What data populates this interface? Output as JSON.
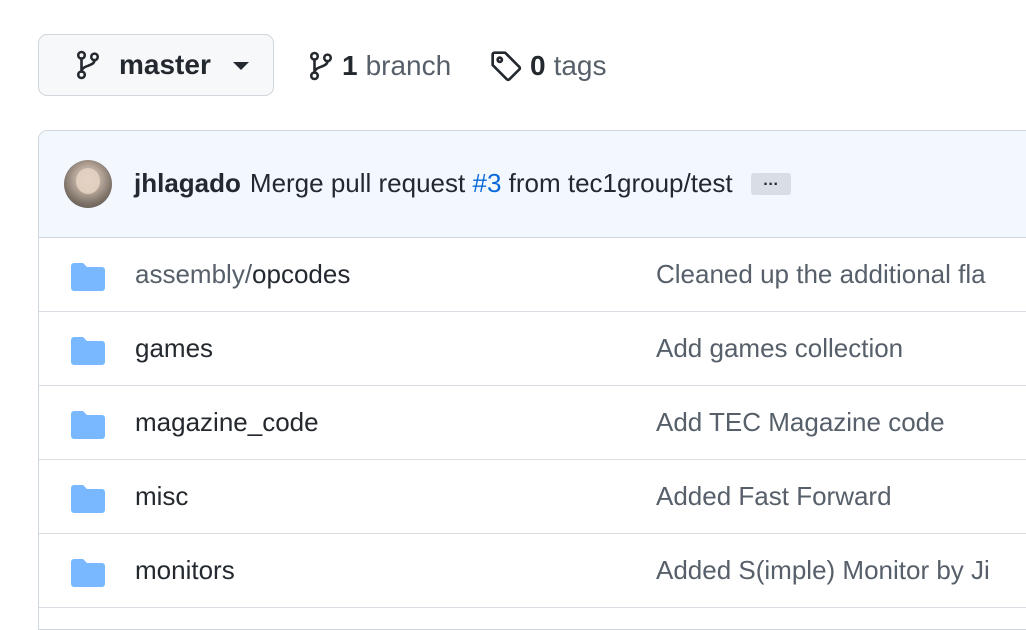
{
  "branch_selector": {
    "label": "master"
  },
  "branches": {
    "count": "1",
    "label": "branch"
  },
  "tags": {
    "count": "0",
    "label": "tags"
  },
  "latest_commit": {
    "author": "jhlagado",
    "message_prefix": "Merge pull request",
    "pr_link": "#3",
    "message_suffix": "from tec1group/test",
    "ellipsis": "…"
  },
  "files": [
    {
      "prefix": "assembly/",
      "name": "opcodes",
      "message": "Cleaned up the additional fla"
    },
    {
      "prefix": "",
      "name": "games",
      "message": "Add games collection"
    },
    {
      "prefix": "",
      "name": "magazine_code",
      "message": "Add TEC Magazine code"
    },
    {
      "prefix": "",
      "name": "misc",
      "message": "Added Fast Forward"
    },
    {
      "prefix": "",
      "name": "monitors",
      "message": "Added S(imple) Monitor by Ji"
    }
  ],
  "colors": {
    "folder": "#79b8ff",
    "link": "#0969da",
    "commit_bg": "#f3f8ff"
  },
  "icons": {
    "branch": "git-branch-icon",
    "tag": "tag-icon",
    "folder": "folder-icon",
    "caret": "caret-down-icon"
  }
}
